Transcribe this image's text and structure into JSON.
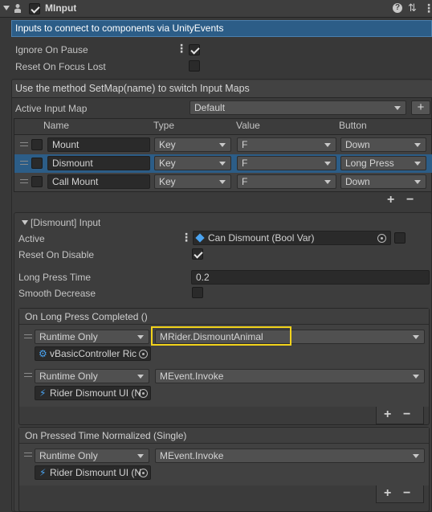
{
  "header": {
    "title": "MInput",
    "enabled": true
  },
  "banner_info": "Inputs to connect to components via UnityEvents",
  "props": {
    "ignore_on_pause_label": "Ignore On Pause",
    "ignore_on_pause": true,
    "reset_focus_label": "Reset On Focus Lost",
    "reset_focus": false
  },
  "banner_map": "Use the method SetMap(name) to switch Input Maps",
  "active_map": {
    "label": "Active Input Map",
    "value": "Default"
  },
  "table": {
    "headers": [
      "Name",
      "Type",
      "Value",
      "Button"
    ],
    "rows": [
      {
        "name": "Mount",
        "type": "Key",
        "value": "F",
        "button": "Down",
        "selected": false
      },
      {
        "name": "Dismount",
        "type": "Key",
        "value": "F",
        "button": "Long Press",
        "selected": true
      },
      {
        "name": "Call Mount",
        "type": "Key",
        "value": "F",
        "button": "Down",
        "selected": false
      }
    ]
  },
  "detail": {
    "title": "[Dismount] Input",
    "active_label": "Active",
    "active_value": "Can Dismount (Bool Var)",
    "reset_disable_label": "Reset On Disable",
    "reset_disable": true,
    "long_press_label": "Long Press Time",
    "long_press_value": "0.2",
    "smooth_label": "Smooth Decrease",
    "smooth": false
  },
  "event1": {
    "title": "On Long Press Completed ()",
    "listeners": [
      {
        "mode": "Runtime Only",
        "function": "MRider.DismountAnimal",
        "target": "vBasicController Ric",
        "highlighted": true
      },
      {
        "mode": "Runtime Only",
        "function": "MEvent.Invoke",
        "target": "Rider Dismount UI (N",
        "highlighted": false
      }
    ]
  },
  "event2": {
    "title": "On Pressed Time Normalized (Single)",
    "listeners": [
      {
        "mode": "Runtime Only",
        "function": "MEvent.Invoke",
        "target": "Rider Dismount UI (N"
      }
    ]
  },
  "glyphs": {
    "plus": "+",
    "minus": "−",
    "kebab": "⋮",
    "help": "?",
    "settings": "⇅",
    "more": "⋮"
  },
  "colors": {
    "accent": "#2c5d87",
    "highlight": "#f2d31b",
    "background": "#383838"
  }
}
